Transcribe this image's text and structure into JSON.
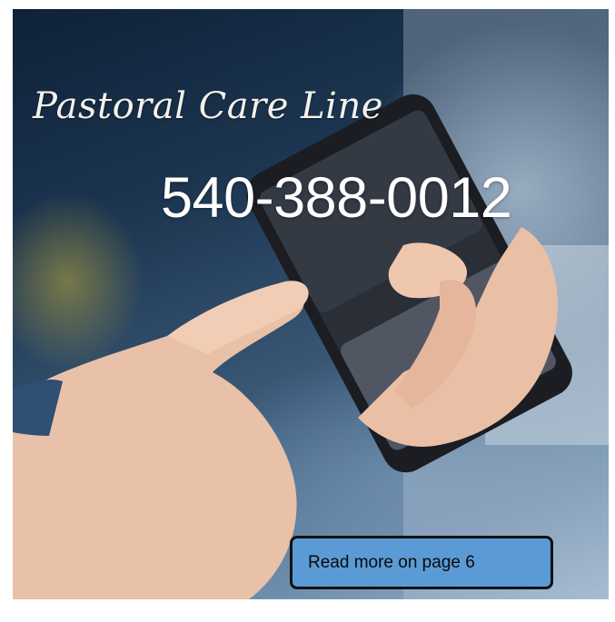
{
  "flyer": {
    "title": "Pastoral Care Line",
    "phone": "540-388-0012",
    "read_more": "Read more on page 6"
  },
  "colors": {
    "button_fill": "#5b9bd5",
    "button_border": "#111111",
    "text_light": "#ffffff"
  },
  "image": {
    "subject": "hands-holding-smartphone-photo"
  }
}
